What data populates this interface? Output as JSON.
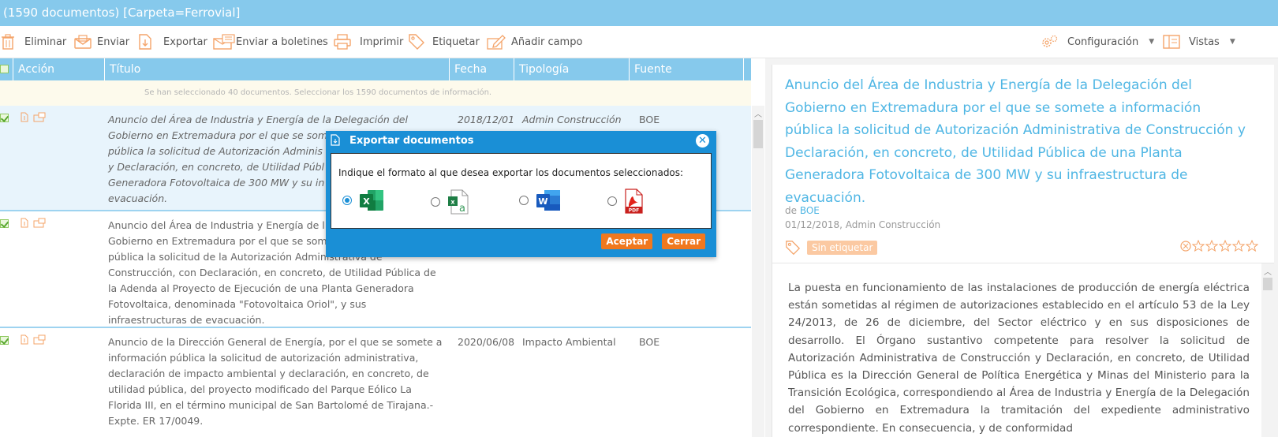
{
  "header": {
    "count_label": "(1590 documentos)",
    "folder_label": "[Carpeta=Ferrovial]"
  },
  "toolbar": {
    "delete_label": "Eliminar",
    "send_label": "Enviar",
    "export_label": "Exportar",
    "bulletin_label": "Enviar a boletines",
    "print_label": "Imprimir",
    "tag_label": "Etiquetar",
    "addfield_label": "Añadir campo",
    "config_label": "Configuración",
    "views_label": "Vistas"
  },
  "list": {
    "columns": {
      "accion": "Acción",
      "titulo": "Título",
      "fecha": "Fecha",
      "tipologia": "Tipología",
      "fuente": "Fuente"
    },
    "notice": "Se han seleccionado 40 documentos. Seleccionar los 1590 documentos de información.",
    "rows": [
      {
        "title_lines": [
          "Anuncio del Área de Industria y Energía de la Delegación del",
          "Gobierno en Extremadura por el que se some",
          "pública la solicitud de Autorización Adminis",
          "y Declaración, en concreto, de Utilidad Públ",
          "Generadora Fotovoltaica de 300 MW y su in",
          "evacuación."
        ],
        "date": "2018/12/01",
        "tipologia": "Admin Construcción",
        "fuente": "BOE"
      },
      {
        "title_lines": [
          "Anuncio del Área de Industria y Energía de l",
          "Gobierno en Extremadura por el que se som",
          "pública la solicitud de la Autorización Administrativa de",
          "Construcción, con Declaración, en concreto, de Utilidad Pública de",
          "la Adenda al Proyecto de Ejecución de una Planta Generadora",
          "Fotovoltaica, denominada \"Fotovoltaica Oriol\", y sus",
          "infraestructuras de evacuación."
        ],
        "date": "",
        "tipologia": "",
        "fuente": ""
      },
      {
        "title_lines": [
          "Anuncio de la Dirección General de Energía, por el que se somete a",
          "información pública la solicitud de autorización administrativa,",
          "declaración de impacto ambiental y declaración, en concreto, de",
          "utilidad pública, del proyecto modificado del Parque Eólico La",
          "Florida III, en el término municipal de San Bartolomé de Tirajana.-",
          "Expte. ER 17/0049."
        ],
        "date": "2020/06/08",
        "tipologia": "Impacto Ambiental",
        "fuente": "BOE"
      }
    ]
  },
  "detail": {
    "title_lines": [
      "Anuncio del Área de Industria y Energía de la Delegación del",
      "Gobierno en Extremadura por el que se somete a información",
      "pública la solicitud de Autorización Administrativa de Construcción y",
      "Declaración, en concreto, de Utilidad Pública de una Planta",
      "Generadora Fotovoltaica de 300 MW y su infraestructura de",
      "evacuación."
    ],
    "source_prefix": "de",
    "source": "BOE",
    "meta": "01/12/2018, Admin Construcción",
    "tag_badge": "Sin etiquetar",
    "body": "La puesta en funcionamiento de las instalaciones de producción de energía eléctrica están sometidas al régimen de autorizaciones establecido en el artículo 53 de la Ley 24/2013, de 26 de diciembre, del Sector eléctrico y en sus disposiciones de desarrollo. El Órgano sustantivo competente para resolver la solicitud de Autorización Administrativa de Construcción y Declaración, en concreto, de Utilidad Pública es la Dirección General de Política Energética y Minas del Ministerio para la Transición Ecológica, correspondiendo al Área de Industria y Energía de la Delegación del Gobierno en Extremadura la tramitación del expediente administrativo correspondiente. En consecuencia, y de conformidad"
  },
  "modal": {
    "title": "Exportar documentos",
    "question": "Indique el formato al que desea exportar los documentos seleccionados:",
    "formats": [
      "excel-icon",
      "excel-text-icon",
      "word-icon",
      "pdf-icon"
    ],
    "selected_format": "excel-icon",
    "accept_label": "Aceptar",
    "close_label": "Cerrar"
  },
  "colors": {
    "header_bg": "#86c9ec",
    "accent": "#1a8fd6",
    "link": "#4fb6e4",
    "orange": "#f0781e",
    "tag_bg": "#fbc9a2"
  }
}
